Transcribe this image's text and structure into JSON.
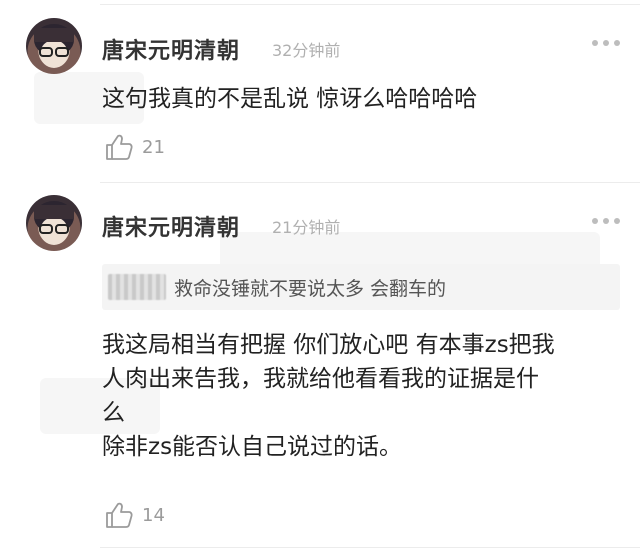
{
  "comments": [
    {
      "username": "唐宋元明清朝",
      "time": "32分钟前",
      "lines": [
        "这句我真的不是乱说 惊讶么哈哈哈哈"
      ],
      "likes": "21"
    },
    {
      "username": "唐宋元明清朝",
      "time": "21分钟前",
      "quote": "救命没锤就不要说太多 会翻车的",
      "lines": [
        "我这局相当有把握 你们放心吧 有本事zs把我",
        "人肉出来告我，我就给他看看我的证据是什",
        "么",
        "除非zs能否认自己说过的话。"
      ],
      "likes": "14"
    }
  ],
  "icons": {
    "more": "more-dots-icon",
    "like": "thumbs-up-icon"
  }
}
